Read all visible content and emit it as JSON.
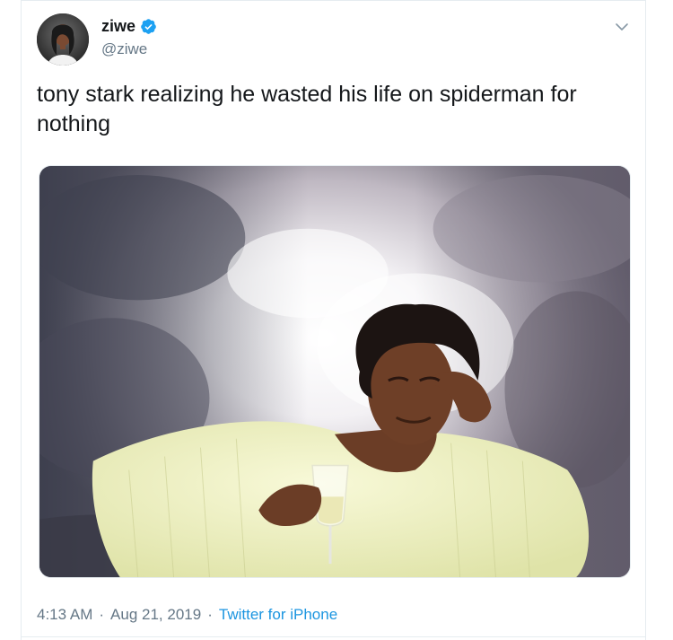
{
  "tweet": {
    "author": {
      "display_name": "ziwe",
      "handle": "@ziwe",
      "verified": true,
      "avatar_icon": "profile-photo"
    },
    "menu_icon": "chevron-down-icon",
    "text": "tony stark realizing he wasted his life on spiderman for nothing",
    "media": {
      "type": "photo",
      "description_icon": "meme-photo"
    },
    "footer": {
      "time": "4:13 AM",
      "separator": "·",
      "date": "Aug 21, 2019",
      "source": "Twitter for iPhone"
    }
  },
  "colors": {
    "text_primary": "#14171a",
    "text_secondary": "#657786",
    "link": "#1b95e0",
    "verified_badge": "#1da1f2",
    "border": "#e6ecf0"
  }
}
